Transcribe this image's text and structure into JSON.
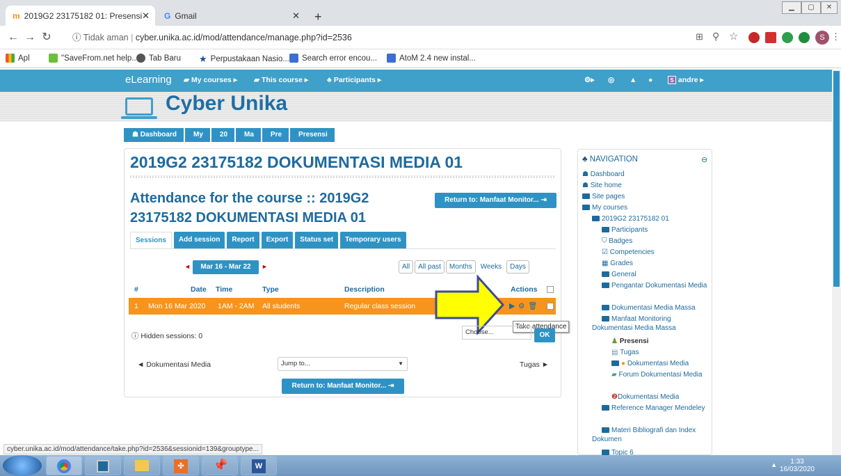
{
  "browser": {
    "tabs": [
      {
        "title": "2019G2 23175182 01: Presensi",
        "active": true
      },
      {
        "title": "Gmail",
        "active": false
      }
    ],
    "new_tab": "+",
    "security": "Tidak aman",
    "url": "cyber.unika.ac.id/mod/attendance/manage.php?id=2536",
    "bookmarks": [
      "Apl",
      "\"SaveFrom.net help...",
      "Tab Baru",
      "Perpustakaan Nasio...",
      "Search error encou...",
      "AtoM 2.4 new instal..."
    ],
    "profile_initial": "S"
  },
  "moodle": {
    "brand": "eLearning",
    "menu": [
      "My courses ▸",
      "This course ▸",
      "Participants ▸"
    ],
    "user": "andre ▸",
    "user_initial": "S",
    "site_name": "Cyber Unika",
    "breadcrumb": [
      "Dashboard",
      "My",
      "20",
      "Ma",
      "Pre",
      "Presensi"
    ]
  },
  "main": {
    "course_title": "2019G2 23175182 DOKUMENTASI MEDIA 01",
    "attendance_title": "Attendance for the course :: 2019G2 23175182 DOKUMENTASI MEDIA 01",
    "return_button": "Return to: Manfaat Monitor... ⇥",
    "tabs": [
      "Sessions",
      "Add session",
      "Report",
      "Export",
      "Status set",
      "Temporary users"
    ],
    "date_range": "Mar 16 - Mar 22",
    "views": [
      "All",
      "All past",
      "Months",
      "Weeks",
      "Days"
    ],
    "columns": {
      "num": "#",
      "date": "Date",
      "time": "Time",
      "type": "Type",
      "description": "Description",
      "actions": "Actions"
    },
    "row": {
      "num": "1",
      "date": "Mon 16 Mar 2020",
      "time": "1AM - 2AM",
      "type": "All students",
      "description": "Regular class session"
    },
    "tooltip": "Take attendance",
    "hidden_sessions": "Hidden sessions: 0",
    "choose": "Choose...",
    "ok": "OK",
    "prev_link": "◄ Dokumentasi Media",
    "jump_to": "Jump to...",
    "next_link": "Tugas ►",
    "return_button_bottom": "Return to: Manfaat Monitor... ⇥"
  },
  "navigation": {
    "title": "NAVIGATION",
    "items": [
      "Dashboard",
      "Site home",
      "Site pages",
      "My courses",
      "2019G2 23175182 01",
      "Participants",
      "Badges",
      "Competencies",
      "Grades",
      "General",
      "Pengantar Dokumentasi Media",
      "Dokumentasi Media Massa",
      "Manfaat Monitoring Dokumentasi Media Massa",
      "Presensi",
      "Tugas",
      "Dokumentasi Media",
      "Forum Dokumentasi Media",
      "Dokumentasi Media",
      "Reference Manager Mendeley",
      "Materi Bibliografi dan Index Dokumen",
      "Topic 6"
    ]
  },
  "status_url": "cyber.unika.ac.id/mod/attendance/take.php?id=2536&sessionid=139&grouptype...",
  "clock": {
    "time": "1:33",
    "date": "16/03/2020"
  },
  "colors": {
    "moodle_blue": "#3fa0c9",
    "accent_orange": "#f7941d",
    "arrow_yellow": "#ffff00",
    "arrow_border": "#3b4a9c"
  }
}
